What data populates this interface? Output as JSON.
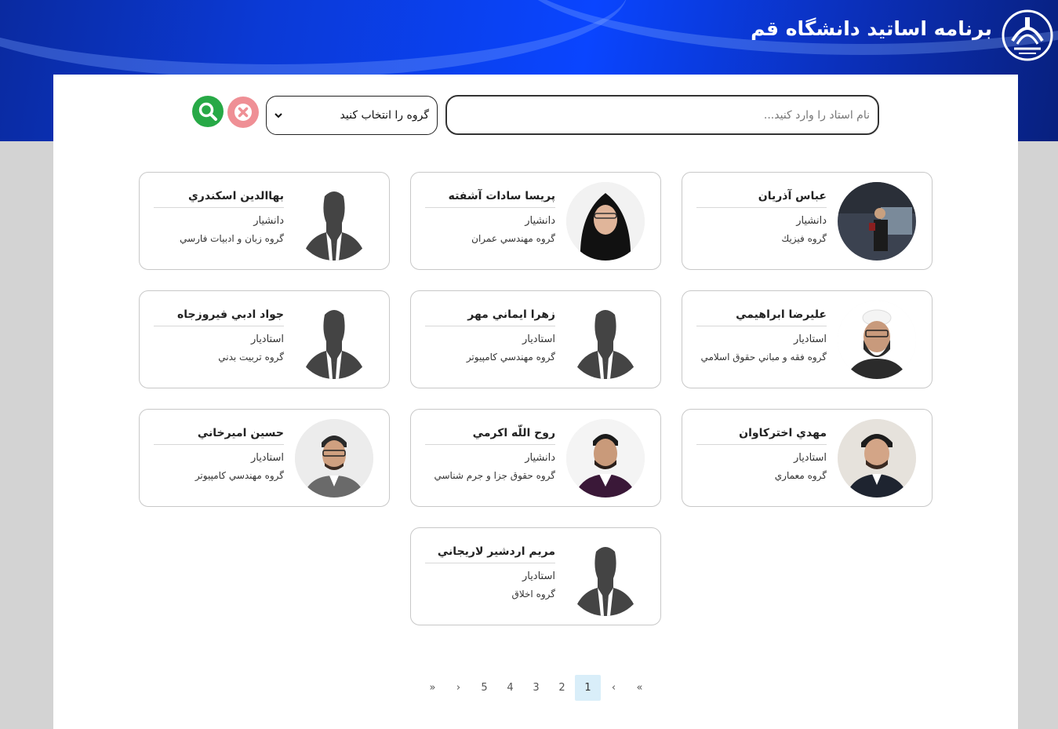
{
  "header": {
    "title": "برنامه اساتید دانشگاه قم",
    "logo_icon": "university-of-qom-logo"
  },
  "search": {
    "placeholder": "نام استاد را وارد کنید...",
    "value": ""
  },
  "group_select": {
    "selected": "گروه را انتخاب کنید"
  },
  "buttons": {
    "clear_icon": "close-icon",
    "search_icon": "search-icon"
  },
  "colors": {
    "header_blue": "#0a45ff",
    "clear_button": "#ef8f95",
    "search_button": "#27a946",
    "active_page": "#d9eef9"
  },
  "professors": [
    {
      "name": "عباس آذريان",
      "rank": "دانشيار",
      "group": "گروه فيزيك",
      "photo": "photo"
    },
    {
      "name": "پريسا سادات آشفته",
      "rank": "دانشيار",
      "group": "گروه مهندسي عمران",
      "photo": "photo"
    },
    {
      "name": "بهاالدين اسكندري",
      "rank": "دانشيار",
      "group": "گروه زبان و ادبيات فارسي",
      "photo": "silhouette"
    },
    {
      "name": "عليرضا ابراهيمي",
      "rank": "استاديار",
      "group": "گروه فقه و مباني حقوق اسلامي",
      "photo": "photo"
    },
    {
      "name": "زهرا ايماني مهر",
      "rank": "استاديار",
      "group": "گروه مهندسي كامپيوتر",
      "photo": "silhouette"
    },
    {
      "name": "جواد ادبي فيروزجاه",
      "rank": "استاديار",
      "group": "گروه تربيت بدني",
      "photo": "silhouette"
    },
    {
      "name": "مهدي اختركاوان",
      "rank": "استاديار",
      "group": "گروه معماري",
      "photo": "photo"
    },
    {
      "name": "روح اللّه اكرمي",
      "rank": "دانشيار",
      "group": "گروه حقوق جزا و جرم شناسي",
      "photo": "photo"
    },
    {
      "name": "حسين اميرخاني",
      "rank": "استاديار",
      "group": "گروه مهندسي كامپيوتر",
      "photo": "photo"
    },
    {
      "name": "مريم اردشير لاريجاني",
      "rank": "استاديار",
      "group": "گروه اخلاق",
      "photo": "silhouette"
    }
  ],
  "pagination": {
    "items": [
      "«",
      "‹",
      "1",
      "2",
      "3",
      "4",
      "5",
      "›",
      "»"
    ],
    "active": "1"
  }
}
